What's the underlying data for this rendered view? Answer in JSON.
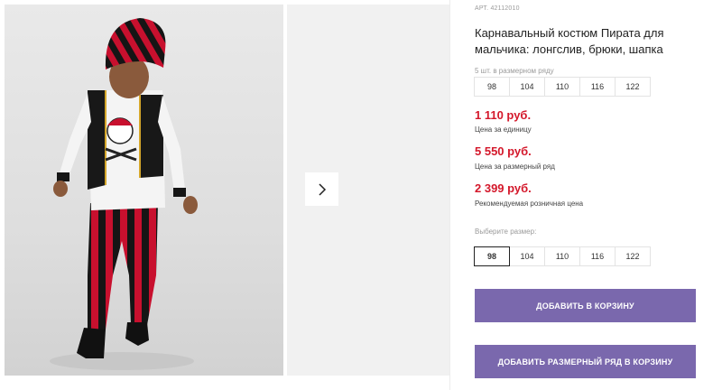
{
  "product": {
    "article_label": "АРТ.",
    "article_number": "42112010",
    "title": "Карнавальный костюм Пирата для мальчика: лонгслив, брюки, шапка"
  },
  "series": {
    "label": "5 шт. в размерном ряду",
    "sizes": [
      "98",
      "104",
      "110",
      "116",
      "122"
    ]
  },
  "prices": {
    "unit_price": "1 110 руб.",
    "unit_caption": "Цена за единицу",
    "series_price": "5 550 руб.",
    "series_caption": "Цена за размерный ряд",
    "retail_price": "2 399 руб.",
    "retail_caption": "Рекомендуемая розничная цена"
  },
  "size_select": {
    "label": "Выберите размер:",
    "options": [
      "98",
      "104",
      "110",
      "116",
      "122"
    ],
    "selected": "98"
  },
  "buttons": {
    "add_to_cart": "ДОБАВИТЬ В КОРЗИНУ",
    "add_series_to_cart": "ДОБАВИТЬ РАЗМЕРНЫЙ РЯД В КОРЗИНУ"
  },
  "icons": {
    "next": "chevron-right-icon"
  },
  "colors": {
    "price": "#d4182b",
    "button": "#7a68ad",
    "selected_border": "#222222"
  }
}
